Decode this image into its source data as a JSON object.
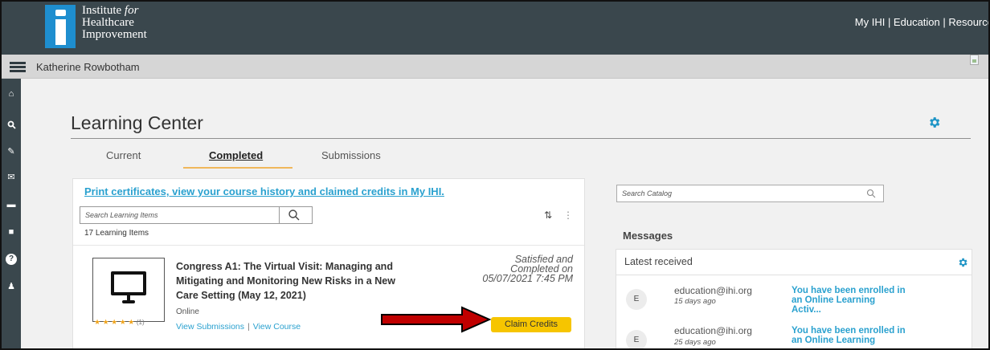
{
  "header": {
    "logo_line1": "Institute",
    "logo_line1_em": "for",
    "logo_line2": "Healthcare",
    "logo_line3": "Improvement",
    "links": "My IHI | Education | Resource"
  },
  "namebar": {
    "user": "Katherine Rowbotham"
  },
  "sidebar": {
    "items": [
      {
        "icon": "home-icon",
        "glyph": "⌂"
      },
      {
        "icon": "search-icon",
        "glyph": "🔍"
      },
      {
        "icon": "edit-icon",
        "glyph": "✎"
      },
      {
        "icon": "inbox-icon",
        "glyph": "✉"
      },
      {
        "icon": "briefcase-icon",
        "glyph": "▬"
      },
      {
        "icon": "book-icon",
        "glyph": "■"
      },
      {
        "icon": "help-icon",
        "glyph": "?"
      },
      {
        "icon": "bell-icon",
        "glyph": "♟"
      }
    ]
  },
  "main": {
    "title": "Learning Center",
    "tabs": [
      {
        "label": "Current"
      },
      {
        "label": "Completed"
      },
      {
        "label": "Submissions"
      }
    ]
  },
  "learning": {
    "print_link": "Print certificates, view your course history and claimed credits in My IHI.",
    "search_placeholder": "Search Learning Items",
    "count": "17 Learning Items",
    "course": {
      "title": "Congress A1: The Virtual Visit: Managing and Mitigating and Monitoring New Risks in a New Care Setting (May 12, 2021)",
      "type": "Online",
      "rating_stars": "★ ★ ★ ★ ★",
      "rating_count": "(1)",
      "status_line1": "Satisfied and",
      "status_line2": "Completed on",
      "status_line3": "05/07/2021 7:45 PM",
      "link_submissions": "View Submissions",
      "link_separator": "|",
      "link_course": "View Course",
      "claim_label": "Claim Credits"
    }
  },
  "right": {
    "catalog_placeholder": "Search Catalog",
    "messages_heading": "Messages",
    "latest_label": "Latest received",
    "messages": [
      {
        "avatar": "E",
        "sender": "education@ihi.org",
        "ago": "15 days ago",
        "line1": "You have been enrolled in",
        "line2": "an Online Learning",
        "line3": "Activ..."
      },
      {
        "avatar": "E",
        "sender": "education@ihi.org",
        "ago": "25 days ago",
        "line1": "You have been enrolled in",
        "line2": "an Online Learning",
        "line3": ""
      }
    ]
  },
  "colors": {
    "header_bg": "#3a474d",
    "accent_blue": "#2aa1cf",
    "claim_yellow": "#f6c500",
    "arrow_red": "#c00000",
    "tab_underline": "#f0b75b"
  }
}
